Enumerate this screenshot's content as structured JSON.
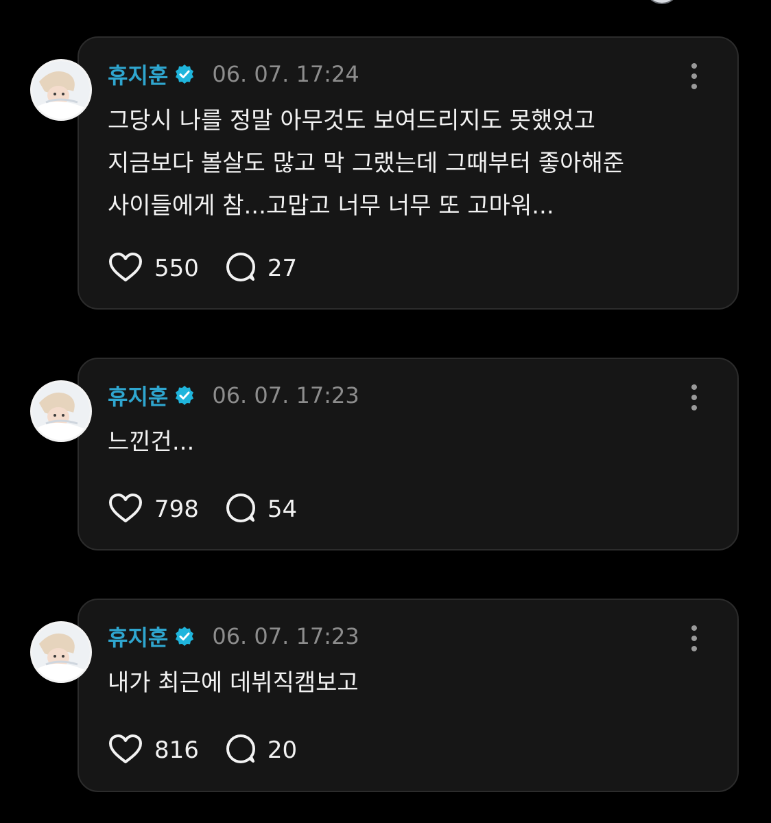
{
  "posts": [
    {
      "author": "휴지훈",
      "timestamp": "06. 07. 17:24",
      "text": "그당시 나를 정말 아무것도 보여드리지도 못했었고\n지금보다 볼살도 많고 막 그랬는데 그때부터 좋아해준\n사이들에게 참...고맙고 너무 너무 또 고마워...",
      "likes": "550",
      "replies": "27"
    },
    {
      "author": "휴지훈",
      "timestamp": "06. 07. 17:23",
      "text": "느낀건...",
      "likes": "798",
      "replies": "54"
    },
    {
      "author": "휴지훈",
      "timestamp": "06. 07. 17:23",
      "text": "내가 최근에 데뷔직캠보고",
      "likes": "816",
      "replies": "20"
    }
  ],
  "icons": {
    "verified": "verified-badge-icon",
    "more": "more-vertical-icon",
    "like": "heart-icon",
    "reply": "speech-bubble-icon"
  },
  "colors": {
    "background": "#000000",
    "card": "#161616",
    "card_border": "#2c2c2c",
    "username": "#2fa6cf",
    "verified": "#1fb5dc",
    "timestamp": "#8d8d8d",
    "text": "#f2f2f2"
  }
}
